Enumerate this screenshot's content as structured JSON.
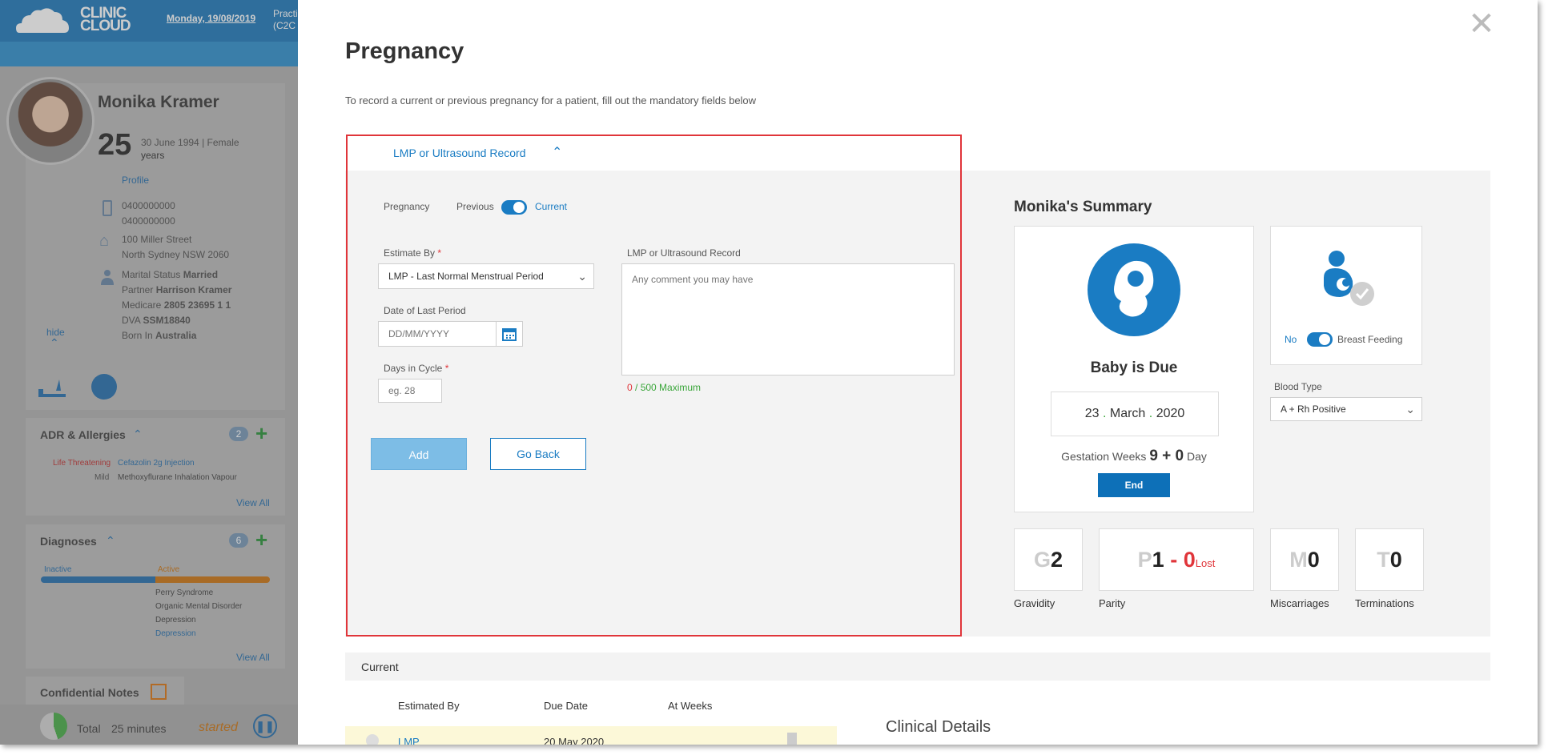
{
  "background_app": {
    "logo": "CLINIC CLOUD",
    "date": "Monday, 19/08/2019",
    "practice_label": "Practi (C2C",
    "patient": {
      "name": "Monika Kramer",
      "age": "25",
      "age_unit": "years",
      "dob_gender": "30 June 1994 | Female",
      "profile_link": "Profile",
      "phone1": "0400000000",
      "phone2": "0400000000",
      "address1": "100 Miller Street",
      "address2": "North Sydney NSW 2060",
      "marital_label": "Marital Status",
      "marital_value": "Married",
      "partner_label": "Partner",
      "partner_value": "Harrison Kramer",
      "medicare_label": "Medicare",
      "medicare_value": "2805 23695 1 1",
      "dva_label": "DVA",
      "dva_value": "SSM18840",
      "born_label": "Born In",
      "born_value": "Australia",
      "hide_link": "hide"
    },
    "adr": {
      "title": "ADR & Allergies",
      "count": "2",
      "items": [
        {
          "severity": "Life Threatening",
          "name": "Cefazolin 2g Injection"
        },
        {
          "severity": "Mild",
          "name": "Methoxyflurane Inhalation Vapour"
        }
      ],
      "view_all": "View All"
    },
    "diagnoses": {
      "title": "Diagnoses",
      "count": "6",
      "inactive_label": "Inactive",
      "active_label": "Active",
      "items": [
        "Perry Syndrome",
        "Organic Mental Disorder",
        "Depression",
        "Depression"
      ],
      "view_all": "View All"
    },
    "confidential_notes": "Confidential Notes",
    "timer": {
      "total_label": "Total",
      "duration": "25 minutes",
      "status": "started"
    }
  },
  "modal": {
    "title": "Pregnancy",
    "subtitle": "To record a current or previous pregnancy for a patient, fill out the mandatory fields below",
    "tab_label": "LMP or Ultrasound Record",
    "form": {
      "pregnancy_label": "Pregnancy",
      "toggle_off_label": "Previous",
      "toggle_on_label": "Current",
      "estimate_by_label": "Estimate By",
      "estimate_by_value": "LMP - Last Normal Menstrual Period",
      "date_last_period_label": "Date of Last Period",
      "date_placeholder": "DD/MM/YYYY",
      "days_cycle_label": "Days in Cycle",
      "days_placeholder": "eg. 28",
      "record_label": "LMP or Ultrasound Record",
      "record_placeholder": "Any comment you may have",
      "char_count": "0",
      "char_max": "/ 500 Maximum",
      "required_mark": "*",
      "add_button": "Add",
      "back_button": "Go Back"
    },
    "summary": {
      "title": "Monika's Summary",
      "due_heading": "Baby is Due",
      "due_day": "23",
      "due_month": "March",
      "due_year": "2020",
      "date_sep": ".",
      "gestation_label": "Gestation Weeks",
      "gestation_weeks": "9 + 0",
      "gestation_unit": "Day",
      "end_button": "End",
      "breastfeeding_off": "No",
      "breastfeeding_label": "Breast Feeding",
      "blood_type_label": "Blood Type",
      "blood_type_value": "A + Rh Positive",
      "stats": {
        "gravidity_letter": "G",
        "gravidity_value": "2",
        "gravidity_label": "Gravidity",
        "parity_letter": "P",
        "parity_value": "1",
        "parity_dash": "-",
        "parity_lost": "0",
        "parity_lost_label": "Lost",
        "parity_label": "Parity",
        "miscarriages_letter": "M",
        "miscarriages_value": "0",
        "miscarriages_label": "Miscarriages",
        "terminations_letter": "T",
        "terminations_value": "0",
        "terminations_label": "Terminations"
      }
    },
    "current": {
      "section_label": "Current",
      "columns": [
        "Estimated By",
        "Due Date",
        "At Weeks"
      ],
      "row": {
        "estimated_by": "LMP",
        "due_date": "20 May 2020"
      },
      "clinical_details": "Clinical Details"
    }
  },
  "colors": {
    "accent": "#1a7cc3",
    "danger": "#e0353a",
    "success": "#3aa63a",
    "highlight_box": "#e0353a"
  }
}
